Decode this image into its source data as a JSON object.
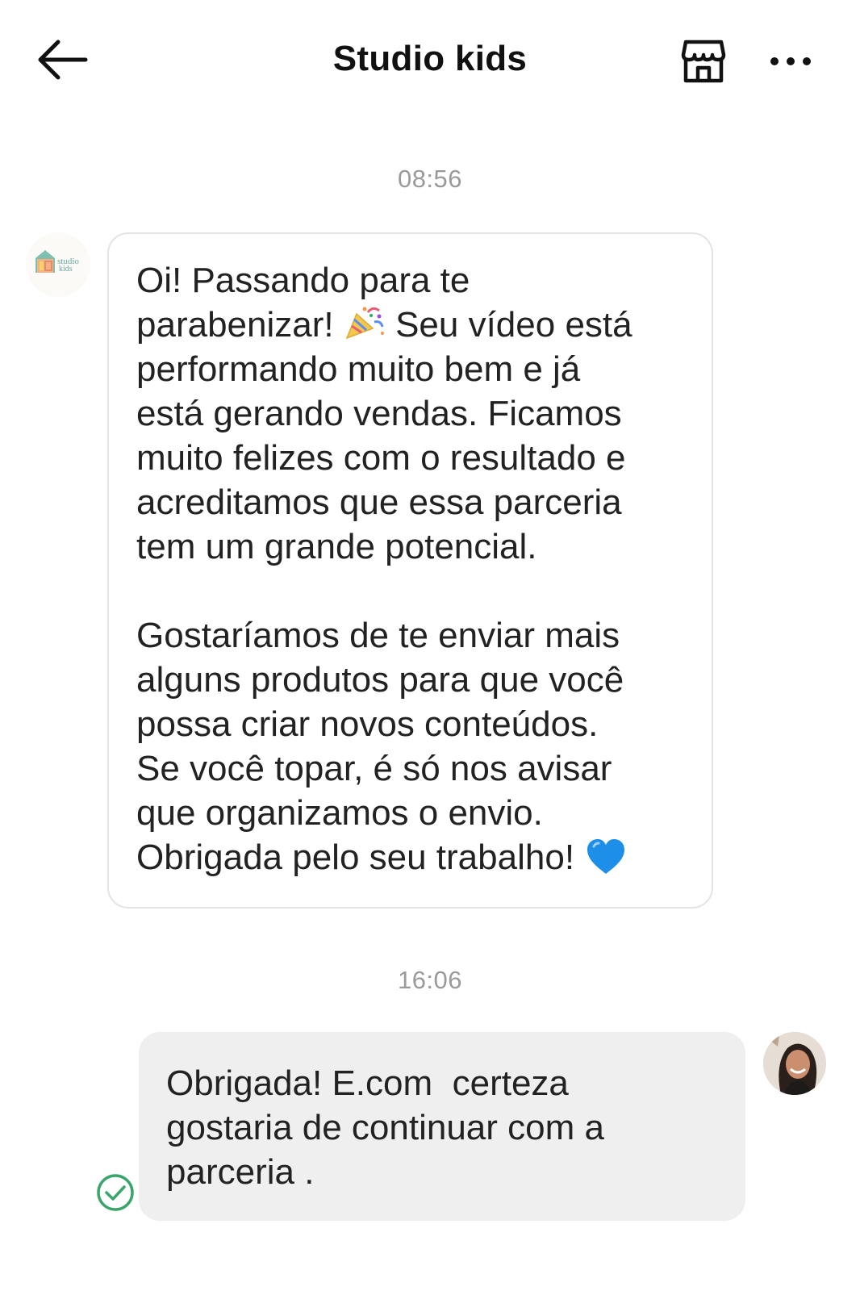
{
  "header": {
    "title": "Studio kids",
    "back_icon": "arrow-left-icon",
    "shop_icon": "storefront-icon",
    "more_icon": "more-horizontal-icon"
  },
  "conversation": {
    "timestamps": [
      "08:56",
      "16:06"
    ],
    "incoming": {
      "avatar_logo": "studio kids",
      "lines_1": "Oi! Passando para te\nparabenizar!",
      "emoji_1": "party-popper",
      "lines_2": " Seu vídeo está\nperformando muito bem e já\nestá gerando vendas. Ficamos\nmuito felizes com o resultado e\nacreditamos que essa parceria\ntem um grande potencial.\n\nGostaríamos de te enviar mais\nalguns produtos para que você\npossa criar novos conteúdos.\nSe você topar, é só nos avisar\nque organizamos o envio.\nObrigada pelo seu trabalho! ",
      "emoji_2": "blue-heart"
    },
    "outgoing": {
      "text": "Obrigada! E.com  certeza\ngostaria de continuar com a\nparceria .",
      "status_icon": "read-check-icon"
    }
  },
  "colors": {
    "incoming_border": "#e3e3e3",
    "outgoing_bg": "#efefef",
    "timestamp": "#9a9a9a",
    "read_check": "#3aa56a",
    "heart": "#1e8fe8"
  }
}
